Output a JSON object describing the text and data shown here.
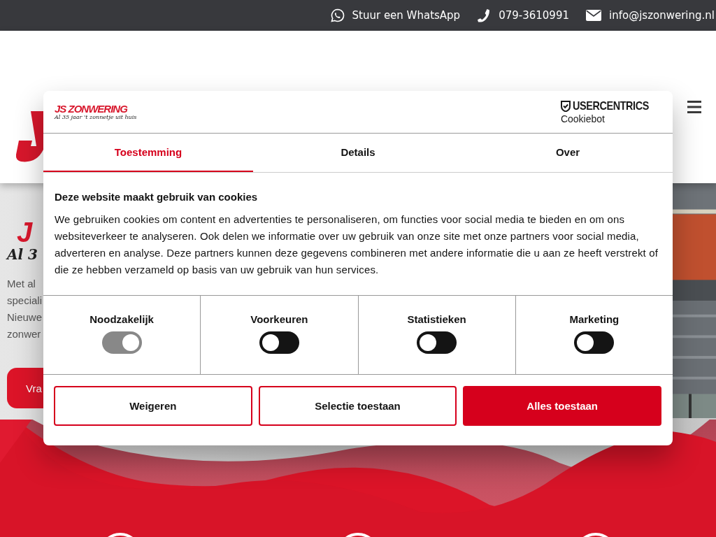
{
  "top_bar": {
    "contacts": [
      {
        "kind": "whatsapp",
        "text": "Stuur een WhatsApp"
      },
      {
        "kind": "phone",
        "text": "079-3610991"
      },
      {
        "kind": "email",
        "text": "info@jszonwering.nl"
      }
    ]
  },
  "hero": {
    "logo": "J",
    "tagline": "Al 3",
    "paragraph_lines": [
      "Met al",
      "speciali",
      "Nieuwe",
      "zonwer"
    ],
    "button": "Vra"
  },
  "cookie_dialog": {
    "brand": {
      "name": "JS ZONWERING",
      "tagline": "Al 35 jaar 't zonnetje uit huis"
    },
    "provider": {
      "name": "USERCENTRICS",
      "product": "Cookiebot"
    },
    "tabs": [
      {
        "label": "Toestemming",
        "selected": true
      },
      {
        "label": "Details",
        "selected": false
      },
      {
        "label": "Over",
        "selected": false
      }
    ],
    "title": "Deze website maakt gebruik van cookies",
    "text": "We gebruiken cookies om content en advertenties te personaliseren, om functies voor social media te bieden en om ons websiteverkeer te analyseren. Ook delen we informatie over uw gebruik van onze site met onze partners voor social media, adverteren en analyse. Deze partners kunnen deze gegevens combineren met andere informatie die u aan ze heeft verstrekt of die ze hebben verzameld op basis van uw gebruik van hun services.",
    "categories": [
      {
        "label": "Noodzakelijk",
        "checked": true,
        "disabled": true
      },
      {
        "label": "Voorkeuren",
        "checked": false,
        "disabled": false
      },
      {
        "label": "Statistieken",
        "checked": false,
        "disabled": false
      },
      {
        "label": "Marketing",
        "checked": false,
        "disabled": false
      }
    ],
    "buttons": [
      {
        "label": "Weigeren",
        "kind": "outline"
      },
      {
        "label": "Selectie toestaan",
        "kind": "outline"
      },
      {
        "label": "Alles toestaan",
        "kind": "filled"
      }
    ]
  }
}
